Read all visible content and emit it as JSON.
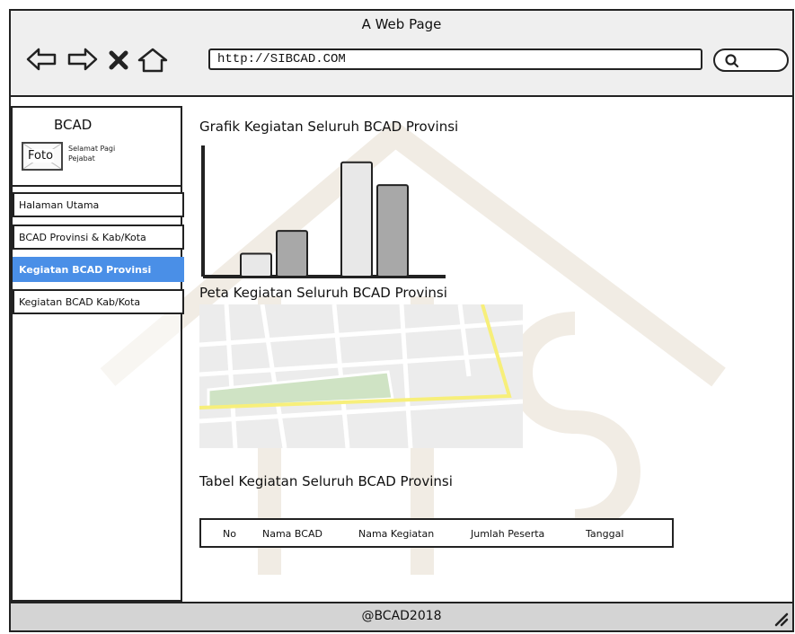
{
  "window": {
    "title": "A Web Page"
  },
  "toolbar": {
    "url": "http://SIBCAD.COM",
    "icons": [
      "back-arrow-icon",
      "forward-arrow-icon",
      "close-x-icon",
      "home-icon",
      "search-icon"
    ]
  },
  "sidebar": {
    "brand": "BCAD",
    "photo_label": "Foto",
    "greeting_line1": "Selamat Pagi",
    "greeting_line2": "Pejabat",
    "items": [
      {
        "label": "Halaman Utama",
        "active": false
      },
      {
        "label": "BCAD Provinsi & Kab/Kota",
        "active": false
      },
      {
        "label": "Kegiatan BCAD Provinsi",
        "active": true
      },
      {
        "label": "Kegiatan BCAD Kab/Kota",
        "active": false
      }
    ]
  },
  "main": {
    "chart_title": "Grafik Kegiatan Seluruh BCAD Provinsi",
    "map_title": "Peta Kegiatan Seluruh BCAD Provinsi",
    "table_title": "Tabel Kegiatan Seluruh BCAD Provinsi",
    "table_headers": [
      "No",
      "Nama BCAD",
      "Nama Kegiatan",
      "Jumlah Peserta",
      "Tanggal"
    ]
  },
  "chart_data": {
    "type": "bar",
    "categories": [
      "",
      ""
    ],
    "series": [
      {
        "values": [
          1,
          5
        ]
      },
      {
        "values": [
          2,
          4
        ]
      }
    ],
    "ylim": [
      0,
      5.5
    ],
    "colors": [
      "#e8e8e8",
      "#a8a8a8"
    ]
  },
  "footer": {
    "text": "@BCAD2018"
  },
  "colors": {
    "active": "#4a8fe7",
    "frame": "#222222",
    "titlebar": "#eeeeee"
  }
}
